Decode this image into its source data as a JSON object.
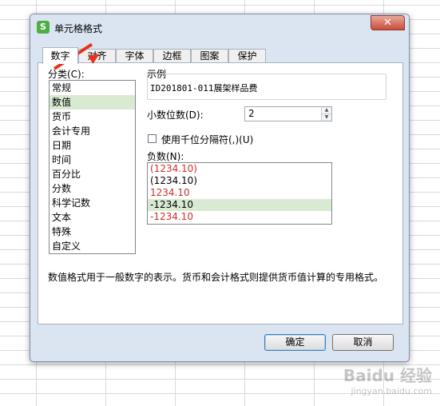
{
  "dialog": {
    "title": "单元格格式",
    "app_icon_letter": "S",
    "close_symbol": "✕"
  },
  "tabs": [
    {
      "label": "数字",
      "active": true
    },
    {
      "label": "对齐",
      "active": false
    },
    {
      "label": "字体",
      "active": false
    },
    {
      "label": "边框",
      "active": false
    },
    {
      "label": "图案",
      "active": false
    },
    {
      "label": "保护",
      "active": false
    }
  ],
  "category": {
    "label": "分类(C):",
    "items": [
      "常规",
      "数值",
      "货币",
      "会计专用",
      "日期",
      "时间",
      "百分比",
      "分数",
      "科学记数",
      "文本",
      "特殊",
      "自定义"
    ],
    "selected_index": 1
  },
  "sample": {
    "label": "示例",
    "value": "ID201801-011展架样品费"
  },
  "decimal_places": {
    "label": "小数位数(D):",
    "value": "2"
  },
  "thousands_separator": {
    "label": "使用千位分隔符(,)(U)",
    "checked": false
  },
  "negative_numbers": {
    "label": "负数(N):",
    "items": [
      {
        "text": "(1234.10)",
        "color": "#d12d2d"
      },
      {
        "text": "(1234.10)",
        "color": "#000000"
      },
      {
        "text": "1234.10",
        "color": "#d12d2d"
      },
      {
        "text": "-1234.10",
        "color": "#000000"
      },
      {
        "text": "-1234.10",
        "color": "#d12d2d"
      }
    ],
    "selected_index": 3
  },
  "description": "数值格式用于一般数字的表示。货币和会计格式则提供货币值计算的专用格式。",
  "buttons": {
    "ok": "确定",
    "cancel": "取消"
  },
  "watermark": {
    "main": "Baidu 经验",
    "sub": "jingyan.baidu.com"
  }
}
